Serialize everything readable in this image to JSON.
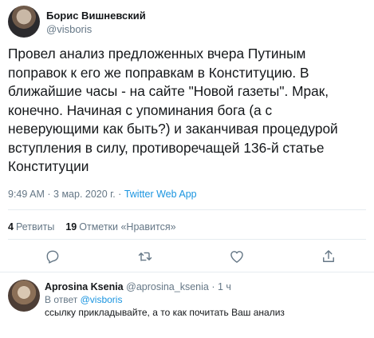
{
  "tweet": {
    "author_name": "Борис Вишневский",
    "author_handle": "@visboris",
    "text": "Провел анализ предложенных вчера Путиным\nпоправок к его же поправкам в Конституцию. В\nближайшие часы - на сайте \"Новой газеты\". Мрак,\nконечно. Начиная с упоминания бога (а с\nневерующими как быть?) и заканчивая процедурой\nвступления в силу, противоречащей 136-й статье\nКонституции",
    "time": "9:49 AM",
    "separator": "·",
    "date": "3 мар. 2020 г.",
    "source": "Twitter Web App"
  },
  "stats": {
    "retweets_count": "4",
    "retweets_label": "Ретвиты",
    "likes_count": "19",
    "likes_label": "Отметки «Нравится»"
  },
  "actions": {
    "icons": [
      "reply-icon",
      "retweet-icon",
      "like-icon",
      "share-icon"
    ]
  },
  "reply": {
    "name": "Aprosina Ksenia",
    "handle": "@aprosina_ksenia",
    "time": "1 ч",
    "separator": "·",
    "in_reply_prefix": "В ответ",
    "in_reply_handle": "@visboris",
    "text": "ссылку прикладывайте, а то как почитать Ваш анализ"
  },
  "colors": {
    "text": "#14171a",
    "secondary": "#657786",
    "link": "#1b95e0",
    "divider": "#e6ecf0"
  }
}
